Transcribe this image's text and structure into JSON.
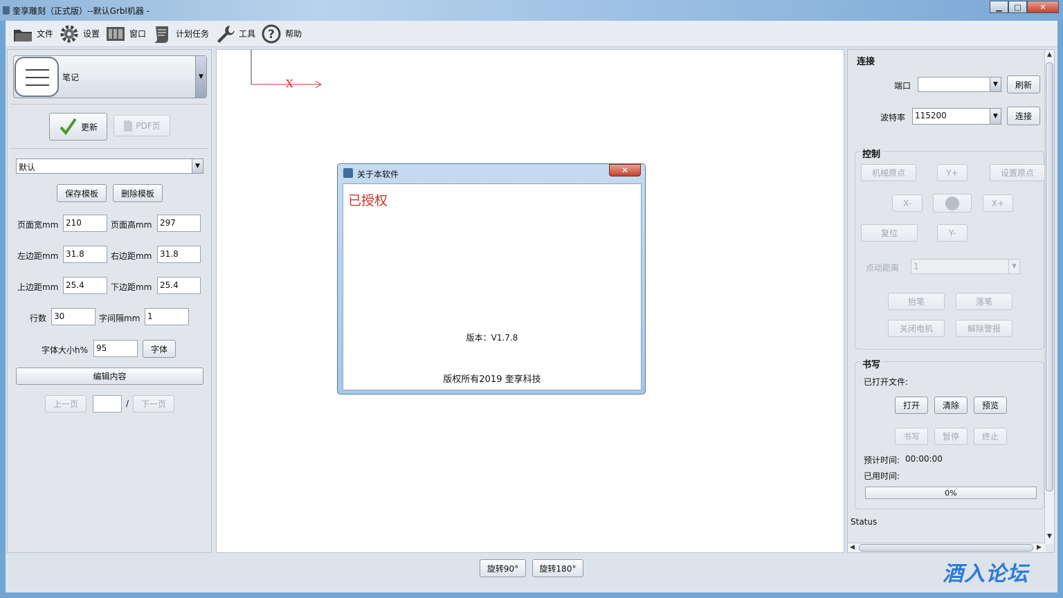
{
  "window": {
    "title": "奎享雕刻（正式版）--默认Grbl机器 -",
    "min_label": "▁",
    "max_label": "□",
    "close_label": "✕"
  },
  "menu": [
    {
      "label": "文件",
      "icon": "folder-icon"
    },
    {
      "label": "设置",
      "icon": "gear-icon"
    },
    {
      "label": "窗口",
      "icon": "window-icon"
    },
    {
      "label": "计划任务",
      "icon": "scroll-icon"
    },
    {
      "label": "工具",
      "icon": "wrench-icon"
    },
    {
      "label": "帮助",
      "icon": "help-icon"
    }
  ],
  "left": {
    "note_label": "笔记",
    "update_label": "更新",
    "pdf_label": "PDF页",
    "template_selected": "默认",
    "save_template": "保存模板",
    "delete_template": "删除模板",
    "page_width_label": "页面宽mm",
    "page_width": "210",
    "page_height_label": "页面高mm",
    "page_height": "297",
    "left_margin_label": "左边距mm",
    "left_margin": "31.8",
    "right_margin_label": "右边距mm",
    "right_margin": "31.8",
    "top_margin_label": "上边距mm",
    "top_margin": "25.4",
    "bottom_margin_label": "下边距mm",
    "bottom_margin": "25.4",
    "rows_label": "行数",
    "rows": "30",
    "char_spacing_label": "字间隔mm",
    "char_spacing": "1",
    "font_size_label": "字体大小h%",
    "font_size": "95",
    "font_button": "字体",
    "edit_content": "编辑内容",
    "prev_page": "上一页",
    "page_input": "",
    "page_sep": "/",
    "next_page": "下一页"
  },
  "canvas": {
    "axis_label": "X"
  },
  "dialog": {
    "title": "关于本软件",
    "close": "✕",
    "licensed": "已授权",
    "version": "版本：V1.7.8",
    "copyright": "版权所有2019  奎享科技"
  },
  "right": {
    "connect_title": "连接",
    "port_label": "端口",
    "port_value": "",
    "refresh": "刷新",
    "baud_label": "波特率",
    "baud_value": "115200",
    "connect": "连接",
    "control_title": "控制",
    "machine_home": "机械原点",
    "y_plus": "Y+",
    "set_origin": "设置原点",
    "x_minus": "X-",
    "x_plus": "X+",
    "reset": "复位",
    "y_minus": "Y-",
    "jog_label": "点动距离",
    "jog_value": "1",
    "pen_up": "抬笔",
    "pen_down": "落笔",
    "motor_off": "关闭电机",
    "clear_alarm": "解除警报",
    "write_title": "书写",
    "opened_file_label": "已打开文件:",
    "open": "打开",
    "clear": "清除",
    "preview": "预览",
    "write": "书写",
    "pause": "暂停",
    "stop": "终止",
    "est_time_label": "预计时间:",
    "est_time": "00:00:00",
    "used_time_label": "已用时间:",
    "progress_text": "0%",
    "progress": 0,
    "status": "Status"
  },
  "bottom": {
    "rotate90": "旋转90°",
    "rotate180": "旋转180°"
  },
  "watermark": "酒入论坛"
}
